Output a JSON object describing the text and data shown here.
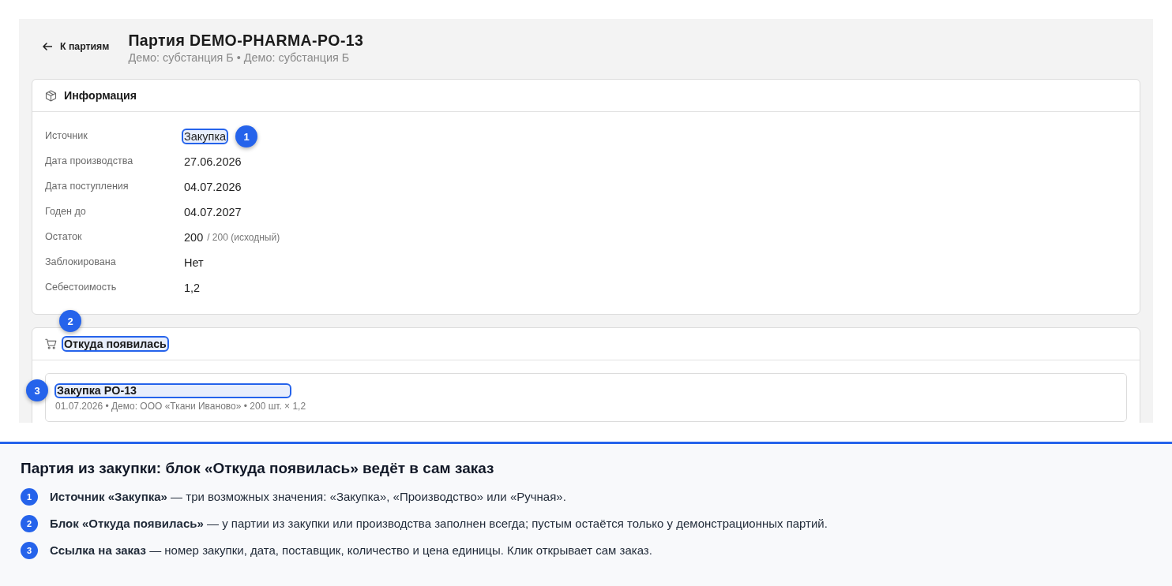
{
  "back_link": {
    "label": "К партиям"
  },
  "header": {
    "title": "Партия DEMO-PHARMA-PO-13",
    "subtitle": "Демо: субстанция Б • Демо: субстанция Б"
  },
  "info_card": {
    "title": "Информация",
    "fields": [
      {
        "label": "Источник",
        "value": "Закупка",
        "highlighted": true,
        "marker": "1"
      },
      {
        "label": "Дата производства",
        "value": "27.06.2026",
        "highlighted": false
      },
      {
        "label": "Дата поступления",
        "value": "04.07.2026",
        "highlighted": false
      },
      {
        "label": "Годен до",
        "value": "04.07.2027",
        "highlighted": false
      },
      {
        "label": "Остаток",
        "value": "200",
        "note": "/ 200 (исходный)",
        "highlighted": false
      },
      {
        "label": "Заблокирована",
        "value": "Нет",
        "highlighted": false
      },
      {
        "label": "Себестоимость",
        "value": "1,2",
        "highlighted": false
      }
    ]
  },
  "origin_card": {
    "title": "Откуда появилась",
    "highlighted": true,
    "marker": "2",
    "order_link": {
      "title": "Закупка PO-13",
      "details": "01.07.2026 • Демо: ООО «Ткани Иваново» • 200 шт. × 1,2",
      "highlighted": true,
      "marker": "3"
    }
  },
  "explanation": {
    "title": "Партия из закупки: блок «Откуда появилась» ведёт в сам заказ",
    "items": [
      {
        "number": "1",
        "text": "**Источник «Закупка»** — три возможных значения: «Закупка», «Производство» или «Ручная»."
      },
      {
        "number": "2",
        "text": "**Блок «Откуда появилась»** — у партии из закупки или производства заполнен всегда; пустым остаётся только у демонстрационных партий."
      },
      {
        "number": "3",
        "text": "**Ссылка на заказ** — номер закупки, дата, поставщик, количество и цена единицы. Клик открывает сам заказ."
      }
    ]
  }
}
